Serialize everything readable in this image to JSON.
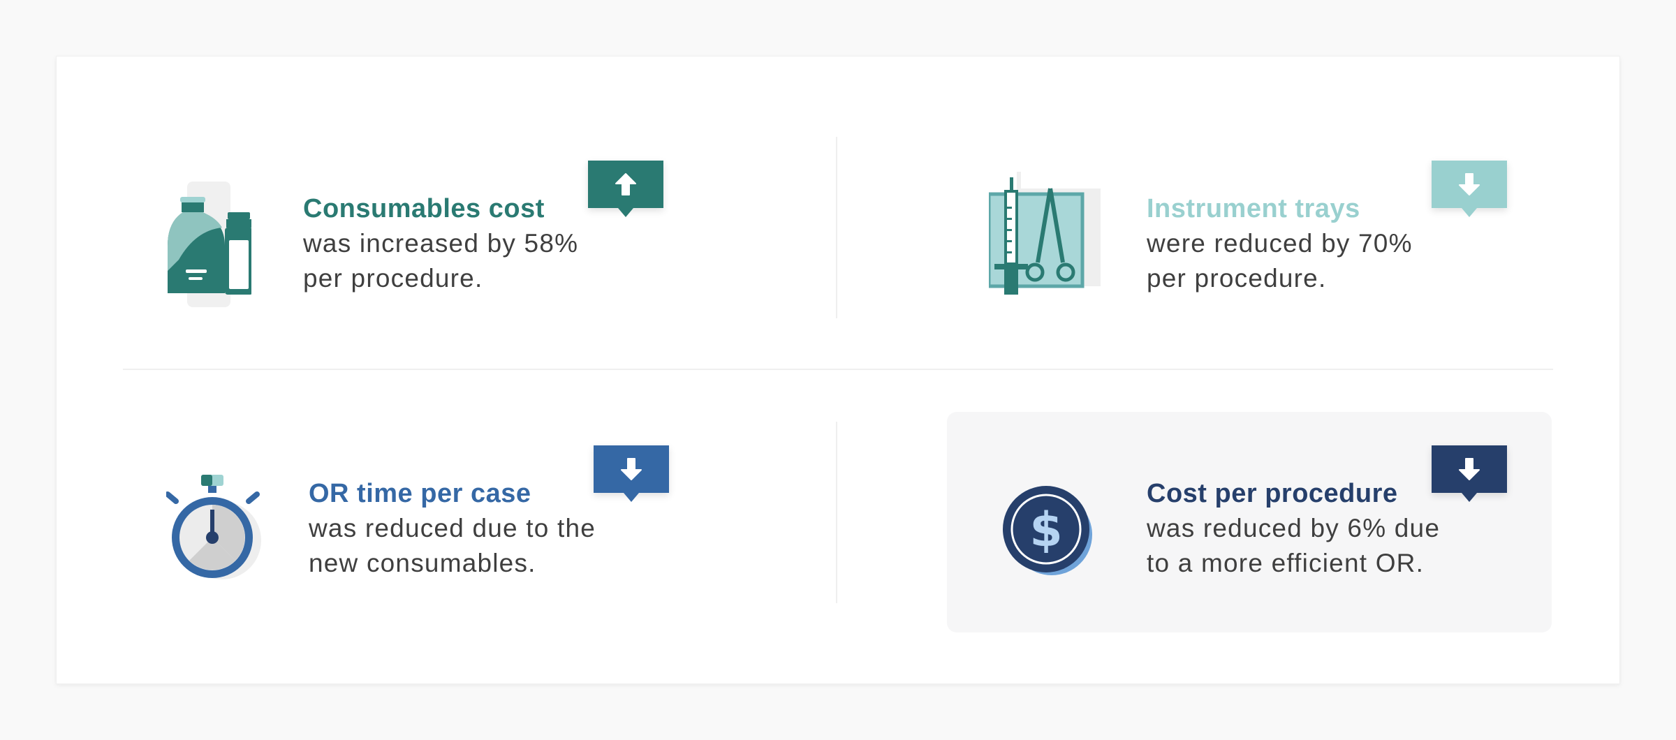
{
  "colors": {
    "teal_dark": "#2a7a72",
    "teal_light": "#99d0cf",
    "blue": "#3568a5",
    "navy": "#263f6b"
  },
  "items": [
    {
      "title": "Consumables cost",
      "line1": "was increased by 58%",
      "line2": "per procedure.",
      "trend": "up",
      "icon": "bottles-icon"
    },
    {
      "title": "Instrument trays",
      "line1": "were reduced by 70%",
      "line2": "per procedure.",
      "trend": "down",
      "icon": "instrument-tray-icon"
    },
    {
      "title": "OR time per case",
      "line1": "was reduced due to the",
      "line2": "new consumables.",
      "trend": "down",
      "icon": "stopwatch-icon"
    },
    {
      "title": "Cost per procedure",
      "line1": "was reduced by 6% due",
      "line2": "to a more efficient OR.",
      "trend": "down",
      "icon": "dollar-coin-icon"
    }
  ]
}
